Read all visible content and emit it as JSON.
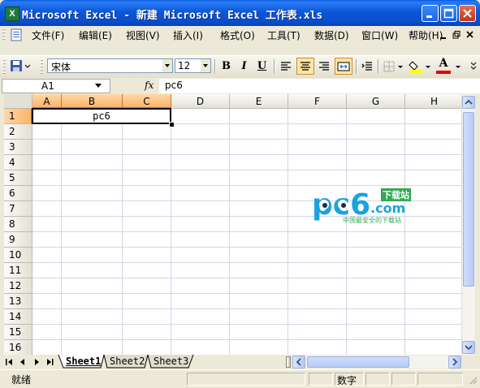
{
  "window": {
    "title": "Microsoft Excel - 新建 Microsoft Excel 工作表.xls"
  },
  "menu": [
    "文件(F)",
    "编辑(E)",
    "视图(V)",
    "插入(I)",
    "格式(O)",
    "工具(T)",
    "数据(D)",
    "窗口(W)",
    "帮助(H)"
  ],
  "toolbar": {
    "font_name": "宋体",
    "font_size": "12",
    "bold_label": "B",
    "italic_label": "I",
    "underline_label": "U",
    "font_color_label": "A"
  },
  "formula_bar": {
    "cell_ref": "A1",
    "fx_label": "fx",
    "content": "pc6"
  },
  "sheet": {
    "columns": [
      "A",
      "B",
      "C",
      "D",
      "E",
      "F",
      "G",
      "H"
    ],
    "rows": [
      "1",
      "2",
      "3",
      "4",
      "5",
      "6",
      "7",
      "8",
      "9",
      "10",
      "11",
      "12",
      "13",
      "14",
      "15",
      "16"
    ],
    "merged_cell_value": "pc6"
  },
  "tabs": [
    "Sheet1",
    "Sheet2",
    "Sheet3"
  ],
  "status": {
    "ready": "就绪",
    "num_lock": "数字"
  },
  "watermark": {
    "logo": "pc6",
    "dotcom": ".com",
    "tagline_top": "下载站",
    "tagline": "中国最安全的下载站"
  },
  "colors": {
    "title_bar": "#0a5ae0",
    "selection": "#f9b569",
    "watermark_blue": "#1aa3e0",
    "watermark_green": "#34a853"
  }
}
